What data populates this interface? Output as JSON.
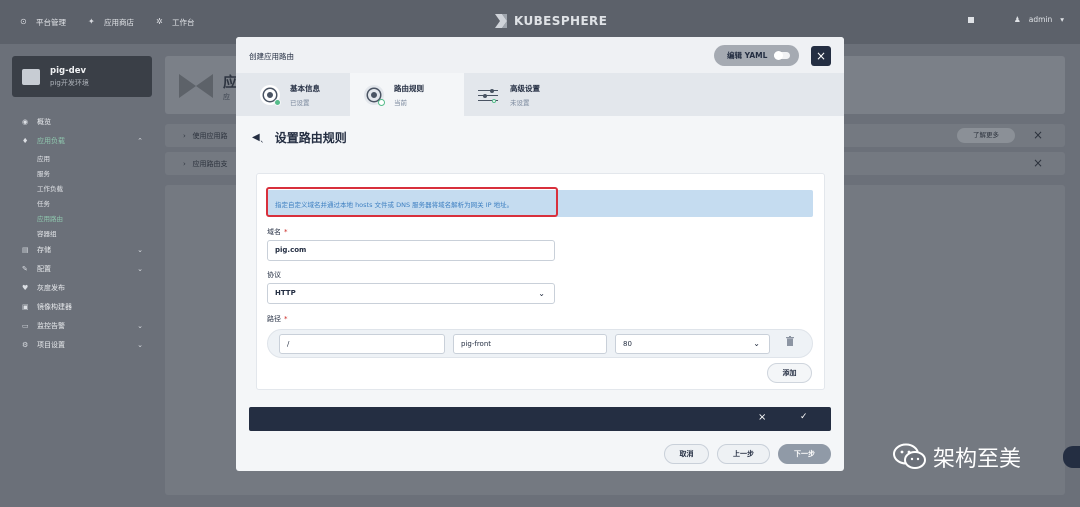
{
  "topbar": {
    "nav": [
      {
        "label": "平台管理",
        "icon": "grid-icon"
      },
      {
        "label": "应用商店",
        "icon": "store-icon"
      },
      {
        "label": "工作台",
        "icon": "dashboard-icon"
      }
    ],
    "brand": "KUBESPHERE",
    "user": "admin"
  },
  "sidebar": {
    "project_name": "pig-dev",
    "project_desc": "pig开发环境",
    "menu": [
      {
        "label": "概览",
        "icon": "overview-icon",
        "expandable": false
      },
      {
        "label": "应用负载",
        "icon": "workload-icon",
        "expandable": true,
        "expanded": true,
        "active": true,
        "children": [
          "应用",
          "服务",
          "工作负载",
          "任务",
          "应用路由",
          "容器组"
        ],
        "active_child": "应用路由"
      },
      {
        "label": "存储",
        "icon": "storage-icon",
        "expandable": true
      },
      {
        "label": "配置",
        "icon": "config-icon",
        "expandable": true
      },
      {
        "label": "灰度发布",
        "icon": "grayscale-icon",
        "expandable": false
      },
      {
        "label": "镜像构建器",
        "icon": "image-builder-icon",
        "expandable": false
      },
      {
        "label": "监控告警",
        "icon": "monitor-icon",
        "expandable": true
      },
      {
        "label": "项目设置",
        "icon": "settings-icon",
        "expandable": true
      }
    ]
  },
  "content": {
    "header_title": "应",
    "header_sub": "应",
    "rows": [
      {
        "label": "使用应用路",
        "button": "了解更多"
      },
      {
        "label": "应用路由支"
      }
    ]
  },
  "modal": {
    "title": "创建应用路由",
    "yaml_label": "编辑 YAML",
    "steps": [
      {
        "label": "基本信息",
        "status": "已设置"
      },
      {
        "label": "路由规则",
        "status": "当前"
      },
      {
        "label": "高级设置",
        "status": "未设置"
      }
    ],
    "section_title": "设置路由规则",
    "info_text": "指定自定义域名并通过本地 hosts 文件或 DNS 服务器将域名解析为网关 IP 地址。",
    "domain_label": "域名",
    "domain_value": "pig.com",
    "protocol_label": "协议",
    "protocol_value": "HTTP",
    "path_label": "路径",
    "path": {
      "path": "/",
      "service": "pig-front",
      "port": "80"
    },
    "add_label": "添加",
    "cancel_label": "取消",
    "prev_label": "上一步",
    "next_label": "下一步"
  },
  "watermark": "架构至美",
  "colors": {
    "accent_green": "#55bc8a",
    "info_bg": "#c5dcf0",
    "info_text": "#3d7fc1",
    "highlight_red": "#d8303c",
    "dark": "#242e42"
  }
}
